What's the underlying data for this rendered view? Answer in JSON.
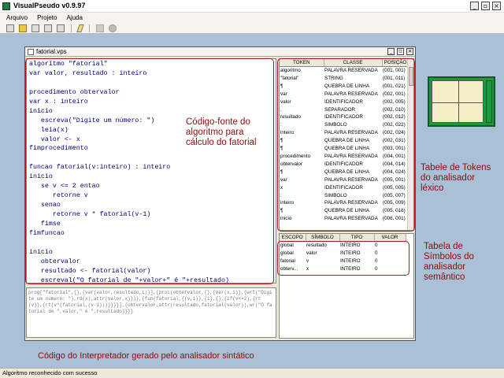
{
  "window": {
    "title": "VisualPseudo v0.9.97"
  },
  "menu": [
    "Arquivo",
    "Projeto",
    "Ajuda"
  ],
  "child": {
    "title": "fatorial.vps"
  },
  "code_lines": [
    "algoritmo \"fatorial\"",
    "var valor, resultado : inteiro",
    "",
    "procedimento obtervalor",
    "var x : inteiro",
    "inicio",
    "   escreva(\"Digite um número: \")",
    "   leia(x)",
    "   valor <- x",
    "fimprocedimento",
    "",
    "funcao fatorial(v:inteiro) : inteiro",
    "inicio",
    "   se v <= 2 entao",
    "      retorne v",
    "   senao",
    "      retorne v * fatorial(v-1)",
    "   fimse",
    "fimfuncao",
    "",
    "inicio",
    "   obtervalor",
    "   resultado <- fatorial(valor)",
    "   escreval(\"O fatorial de \"+valor+\" é \"+resultado)",
    "fimalgoritmo"
  ],
  "generated_code": "prog[\"fatorial\",{},{var(valor,resultado,i)}],{proc(obtervalor,{},{var(x,i)},{wrt(\"Digite um número: \"),rd(x),attr(valor,x)})},{fun(fatorial,{(v,i)},{i},{},{if(v<=2),{rt(v)},{rt(v*(fatorial,(v-1)))}}}}],{obtervalor,attr(resultado,fatorial(valor)),wr(\"O fatorial de \",valor,\" é \",resultado)}}}",
  "tokens": {
    "headers": [
      "TOKEN",
      "CLASSE",
      "POSIÇÃO"
    ],
    "rows": [
      [
        "algoritmo",
        "PALAVRA RESERVADA",
        "(001, 001)"
      ],
      [
        "\"fatorial\"",
        "STRING",
        "(001, 011)"
      ],
      [
        "¶",
        "QUEBRA DE LINHA",
        "(001, 021)"
      ],
      [
        "var",
        "PALAVRA RESERVADA",
        "(002, 001)"
      ],
      [
        "valor",
        "IDENTIFICADOR",
        "(002, 005)"
      ],
      [
        ",",
        "SEPARADOR",
        "(002, 010)"
      ],
      [
        "resultado",
        "IDENTIFICADOR",
        "(002, 012)"
      ],
      [
        ":",
        "SIMBOLO",
        "(002, 022)"
      ],
      [
        "inteiro",
        "PALAVRA RESERVADA",
        "(002, 024)"
      ],
      [
        "¶",
        "QUEBRA DE LINHA",
        "(002, 031)"
      ],
      [
        "¶",
        "QUEBRA DE LINHA",
        "(003, 001)"
      ],
      [
        "procedimento",
        "PALAVRA RESERVADA",
        "(004, 001)"
      ],
      [
        "obtervalor",
        "IDENTIFICADOR",
        "(004, 014)"
      ],
      [
        "¶",
        "QUEBRA DE LINHA",
        "(004, 024)"
      ],
      [
        "var",
        "PALAVRA RESERVADA",
        "(005, 001)"
      ],
      [
        "x",
        "IDENTIFICADOR",
        "(005, 005)"
      ],
      [
        ":",
        "SIMBOLO",
        "(005, 007)"
      ],
      [
        "inteiro",
        "PALAVRA RESERVADA",
        "(005, 009)"
      ],
      [
        "¶",
        "QUEBRA DE LINHA",
        "(005, 016)"
      ],
      [
        "inicio",
        "PALAVRA RESERVADA",
        "(006, 001)"
      ]
    ]
  },
  "symbols": {
    "headers": [
      "ESCOPO",
      "SÍMBOLO",
      "TIPO",
      "VALOR"
    ],
    "rows": [
      [
        "global",
        "resultado",
        "INTEIRO",
        "0"
      ],
      [
        "global",
        "valor",
        "INTEIRO",
        "0"
      ],
      [
        "fatorial",
        "v",
        "INTEIRO",
        "0"
      ],
      [
        "obterv...",
        "x",
        "INTEIRO",
        "0"
      ]
    ]
  },
  "annotations": {
    "source": "Código-fonte do\nalgoritmo para\ncálculo do fatorial",
    "tokens": "Tabele de Tokens\ndo analisador\nléxico",
    "symbols": "Tabela de\nSímbolos do\nanalisador\nsemântico",
    "interpreter": "Código do Interpretador gerado pelo analisador sintático"
  },
  "status": "Algoritmo reconhecido com sucesso",
  "colors": {
    "desktop": "#a9c0d6",
    "annotation": "#8b0d0d",
    "code_text": "#000080"
  }
}
